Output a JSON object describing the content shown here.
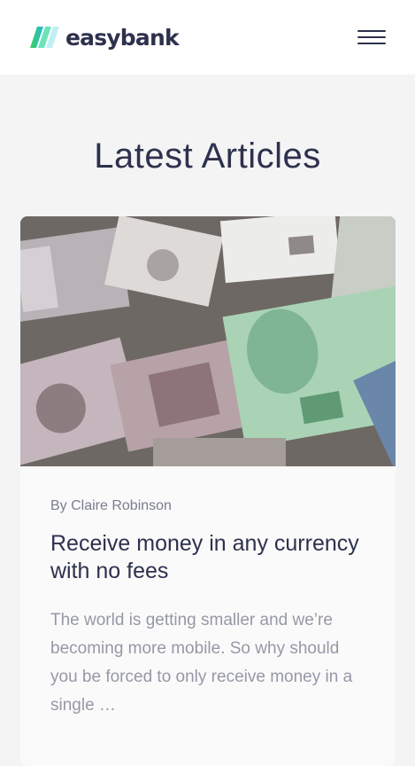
{
  "header": {
    "brand": "easybank",
    "logo_icon": "easybank-logo-icon",
    "menu_icon": "hamburger-icon"
  },
  "section": {
    "title": "Latest Articles"
  },
  "article": {
    "image_subject": "money-banknotes",
    "byline": "By Claire Robinson",
    "title": "Receive money in any currency with no fees",
    "excerpt": "The world is getting smaller and we’re becoming more mobile. So why should you be forced to only receive money in a single …"
  },
  "colors": {
    "heading": "#2d314d",
    "muted": "#9698a6",
    "page_bg": "#f4f4f5",
    "card_bg": "#fafafa",
    "brand_green": "#31d35c",
    "brand_cyan": "#2bb7da"
  }
}
